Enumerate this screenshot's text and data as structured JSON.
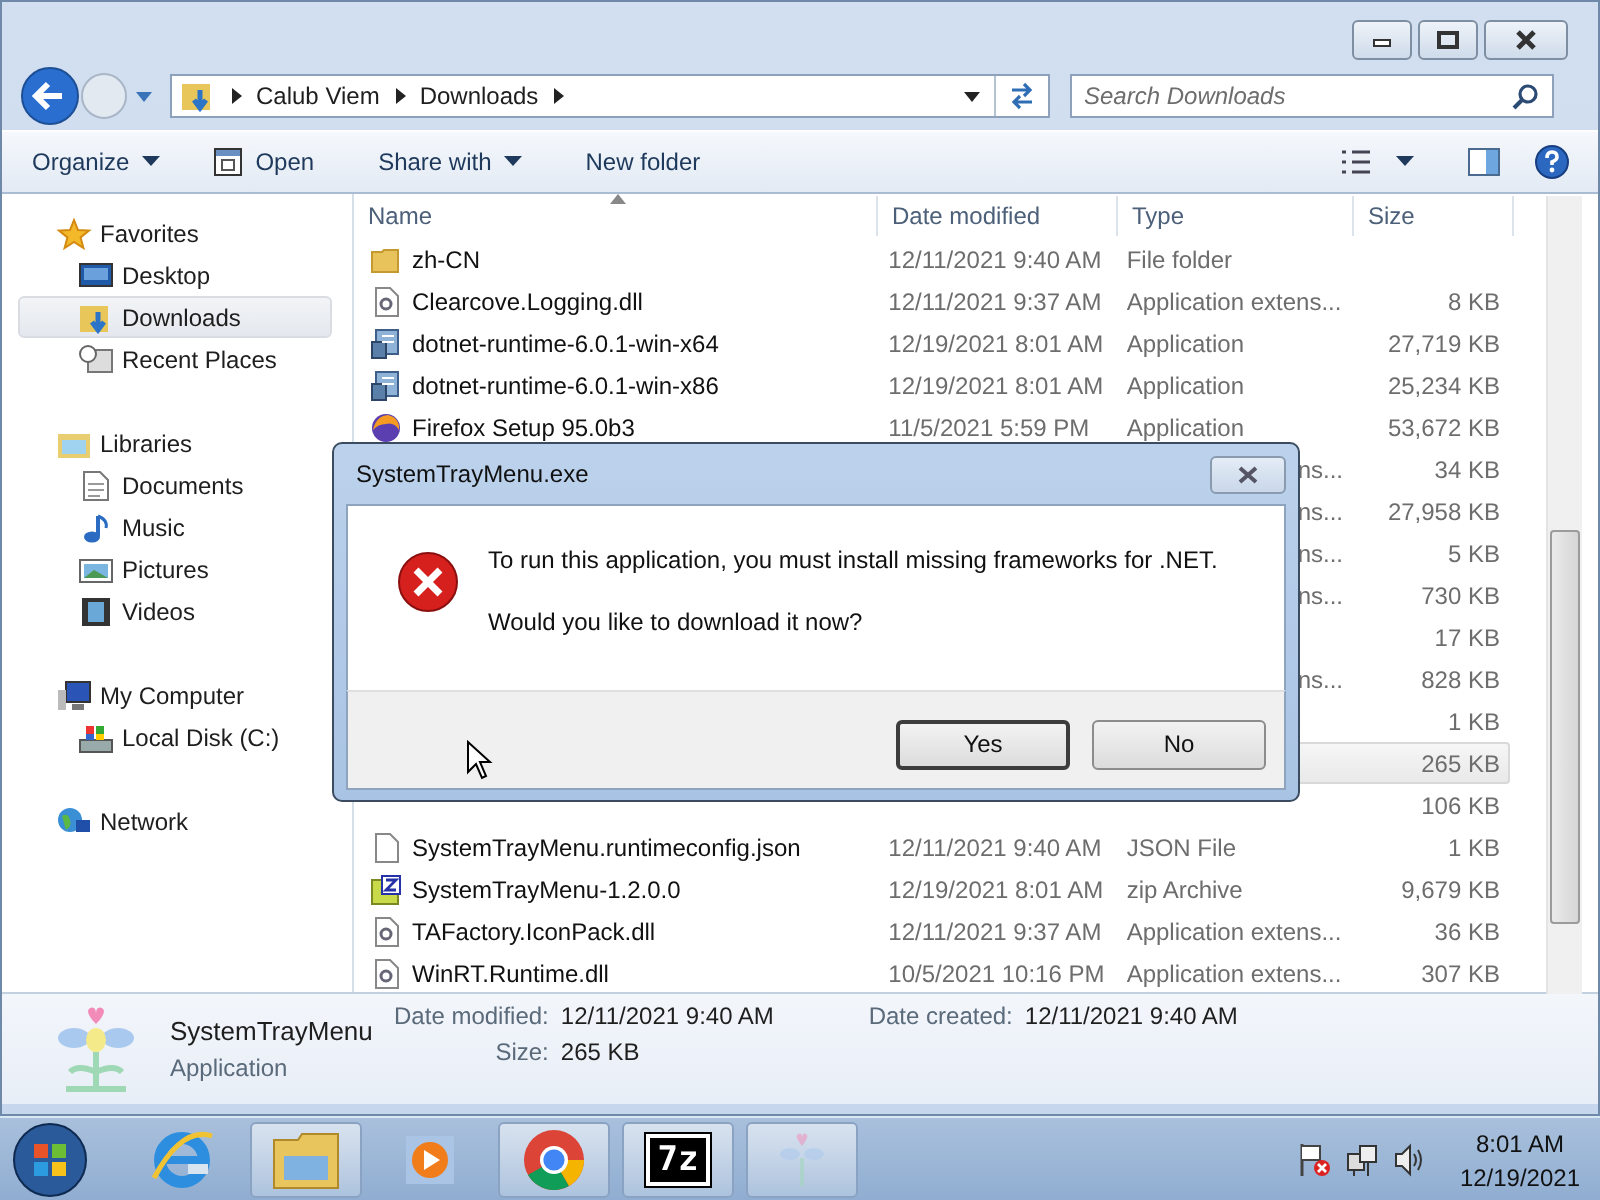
{
  "address_bar": {
    "crumbs": [
      "Calub Viem",
      "Downloads"
    ]
  },
  "search": {
    "placeholder": "Search Downloads"
  },
  "toolbar": [
    {
      "label": "Organize",
      "kind": "menu"
    },
    {
      "label": "Open",
      "kind": "open"
    },
    {
      "label": "Share with",
      "kind": "menu"
    },
    {
      "label": "New folder",
      "kind": "plain"
    }
  ],
  "sidebar": [
    {
      "label": "Favorites",
      "kind": "star",
      "children": [
        {
          "label": "Desktop",
          "kind": "desktop",
          "selected": false
        },
        {
          "label": "Downloads",
          "kind": "downloads",
          "selected": true
        },
        {
          "label": "Recent Places",
          "kind": "recent",
          "selected": false
        }
      ]
    },
    {
      "label": "Libraries",
      "kind": "library",
      "children": [
        {
          "label": "Documents",
          "kind": "document",
          "selected": false
        },
        {
          "label": "Music",
          "kind": "music",
          "selected": false
        },
        {
          "label": "Pictures",
          "kind": "pictures",
          "selected": false
        },
        {
          "label": "Videos",
          "kind": "videos",
          "selected": false
        }
      ]
    },
    {
      "label": "My Computer",
      "kind": "computer",
      "children": [
        {
          "label": "Local Disk (C:)",
          "kind": "disk",
          "selected": false
        }
      ]
    },
    {
      "label": "Network",
      "kind": "network"
    }
  ],
  "table": {
    "columns": [
      "Name",
      "Date modified",
      "Type",
      "Size"
    ],
    "rows": [
      {
        "kind": "folder",
        "name": "zh-CN",
        "date": "12/11/2021 9:40 AM",
        "type": "File folder",
        "selected": false
      },
      {
        "kind": "dll",
        "name": "Clearcove.Logging.dll",
        "date": "12/11/2021 9:37 AM",
        "type": "Application extens...",
        "size": "8 KB",
        "selected": false
      },
      {
        "kind": "installer",
        "name": "dotnet-runtime-6.0.1-win-x64",
        "date": "12/19/2021 8:01 AM",
        "type": "Application",
        "size": "27,719 KB",
        "selected": false
      },
      {
        "kind": "installer",
        "name": "dotnet-runtime-6.0.1-win-x86",
        "date": "12/19/2021 8:01 AM",
        "type": "Application",
        "size": "25,234 KB",
        "selected": false
      },
      {
        "kind": "browser",
        "name": "Firefox Setup 95.0b3",
        "date": "11/5/2021 5:59 PM",
        "type": "Application",
        "size": "53,672 KB",
        "selected": false
      },
      {
        "type": "ns...",
        "size": "34 KB",
        "selected": false
      },
      {
        "type": "ns...",
        "size": "27,958 KB",
        "selected": false
      },
      {
        "type": "ns...",
        "size": "5 KB",
        "selected": false
      },
      {
        "type": "ns...",
        "size": "730 KB",
        "selected": false
      },
      {
        "size": "17 KB",
        "selected": false
      },
      {
        "type": "ns...",
        "size": "828 KB",
        "selected": false
      },
      {
        "size": "1 KB",
        "selected": false
      },
      {
        "size": "265 KB",
        "selected": true
      },
      {
        "size": "106 KB",
        "selected": false
      },
      {
        "kind": "document",
        "name": "SystemTrayMenu.runtimeconfig.json",
        "date": "12/11/2021 9:40 AM",
        "type": "JSON File",
        "size": "1 KB",
        "selected": false
      },
      {
        "kind": "archive",
        "name": "SystemTrayMenu-1.2.0.0",
        "date": "12/19/2021 8:01 AM",
        "type": "zip Archive",
        "size": "9,679 KB",
        "selected": false
      },
      {
        "kind": "dll",
        "name": "TAFactory.IconPack.dll",
        "date": "12/11/2021 9:37 AM",
        "type": "Application extens...",
        "size": "36 KB",
        "selected": false
      },
      {
        "kind": "dll",
        "name": "WinRT.Runtime.dll",
        "date": "10/5/2021 10:16 PM",
        "type": "Application extens...",
        "size": "307 KB",
        "selected": false
      }
    ]
  },
  "details": {
    "name": "SystemTrayMenu",
    "type": "Application",
    "fields": [
      {
        "label": "Date modified:",
        "value": "12/11/2021 9:40 AM"
      },
      {
        "label": "Size:",
        "value": "265 KB"
      },
      {
        "label": "Date created:",
        "value": "12/11/2021 9:40 AM"
      }
    ]
  },
  "dialog": {
    "title": "SystemTrayMenu.exe",
    "message": "To run this application, you must install missing frameworks for .NET.",
    "question": "Would you like to download it now?",
    "buttons": [
      {
        "label": "Yes",
        "default": true
      },
      {
        "label": "No",
        "default": false
      }
    ]
  },
  "taskbar": {
    "apps": [
      {
        "kind": "ie",
        "running": false
      },
      {
        "kind": "explorer",
        "running": true
      },
      {
        "kind": "media",
        "running": false
      },
      {
        "kind": "chrome",
        "running": true
      },
      {
        "kind": "archiver",
        "label": "7z",
        "running": true
      },
      {
        "kind": "flower",
        "running": true
      }
    ],
    "clock": {
      "time": "8:01 AM",
      "date": "12/19/2021"
    }
  }
}
